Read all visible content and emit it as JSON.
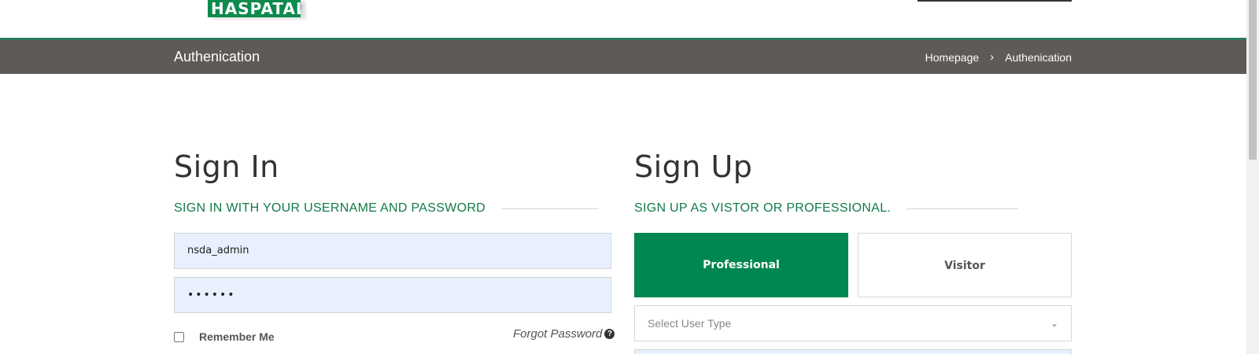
{
  "header": {
    "logo_text": "HASPATAL",
    "logo_mark": "⚕"
  },
  "titlebar": {
    "title": "Authenication",
    "breadcrumb": {
      "home": "Homepage",
      "separator": "›",
      "current": "Authenication"
    }
  },
  "signin": {
    "heading": "Sign In",
    "subheading": "SIGN IN WITH YOUR USERNAME AND PASSWORD",
    "username_value": "nsda_admin",
    "password_value": "••••••",
    "remember_label": "Remember Me",
    "forgot_label": "Forgot Password",
    "forgot_icon": "?"
  },
  "signup": {
    "heading": "Sign Up",
    "subheading": "SIGN UP AS VISTOR OR PROFESSIONAL.",
    "professional_label": "Professional",
    "visitor_label": "Visitor",
    "user_type_placeholder": "Select User Type",
    "chevron": "⌄"
  },
  "colors": {
    "brand_green": "#008650",
    "title_bar": "#5e5a55",
    "accent_text": "#117a48",
    "autofill_bg": "#e8f0fe"
  }
}
